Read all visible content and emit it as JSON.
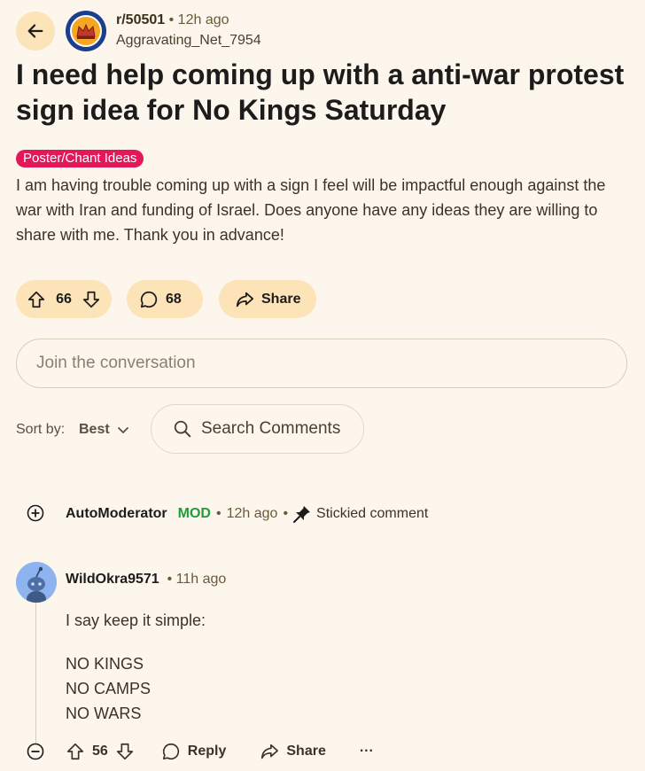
{
  "header": {
    "subreddit": "r/50501",
    "time": "12h ago",
    "author": "Aggravating_Net_7954"
  },
  "post": {
    "title": "I need help coming up with a anti-war protest sign idea for No Kings Saturday",
    "flair": "Poster/Chant Ideas",
    "body": "I am having trouble coming up with a sign I feel will be impactful enough against the war with Iran and funding of Israel. Does anyone have any ideas they are willing to share with me. Thank you in advance!",
    "votes": "66",
    "comments": "68",
    "share_label": "Share"
  },
  "join": {
    "placeholder": "Join the conversation"
  },
  "sort": {
    "label": "Sort by:",
    "value": "Best",
    "search_label": "Search Comments"
  },
  "comments": [
    {
      "author": "AutoModerator",
      "badge": "MOD",
      "time": "12h ago",
      "note": "Stickied comment"
    },
    {
      "author": "WildOkra9571",
      "time": "11h ago",
      "intro": "I say keep it simple:",
      "lines": [
        "NO KINGS",
        "NO CAMPS",
        "NO WARS"
      ],
      "votes": "56",
      "reply_label": "Reply",
      "share_label": "Share",
      "more_label": "···"
    }
  ],
  "colors": {
    "background": "#fdf6ec",
    "pill": "#fce3b8",
    "flair": "#e2185b",
    "mod": "#1e9e3a"
  },
  "icons": {
    "back": "arrow-left-icon",
    "upvote": "arrow-up-icon",
    "downvote": "arrow-down-icon",
    "comment": "speech-bubble-icon",
    "share": "share-arrow-icon",
    "search": "search-icon",
    "pin": "pin-icon",
    "expand": "plus-circle-icon",
    "collapse": "minus-circle-icon"
  }
}
